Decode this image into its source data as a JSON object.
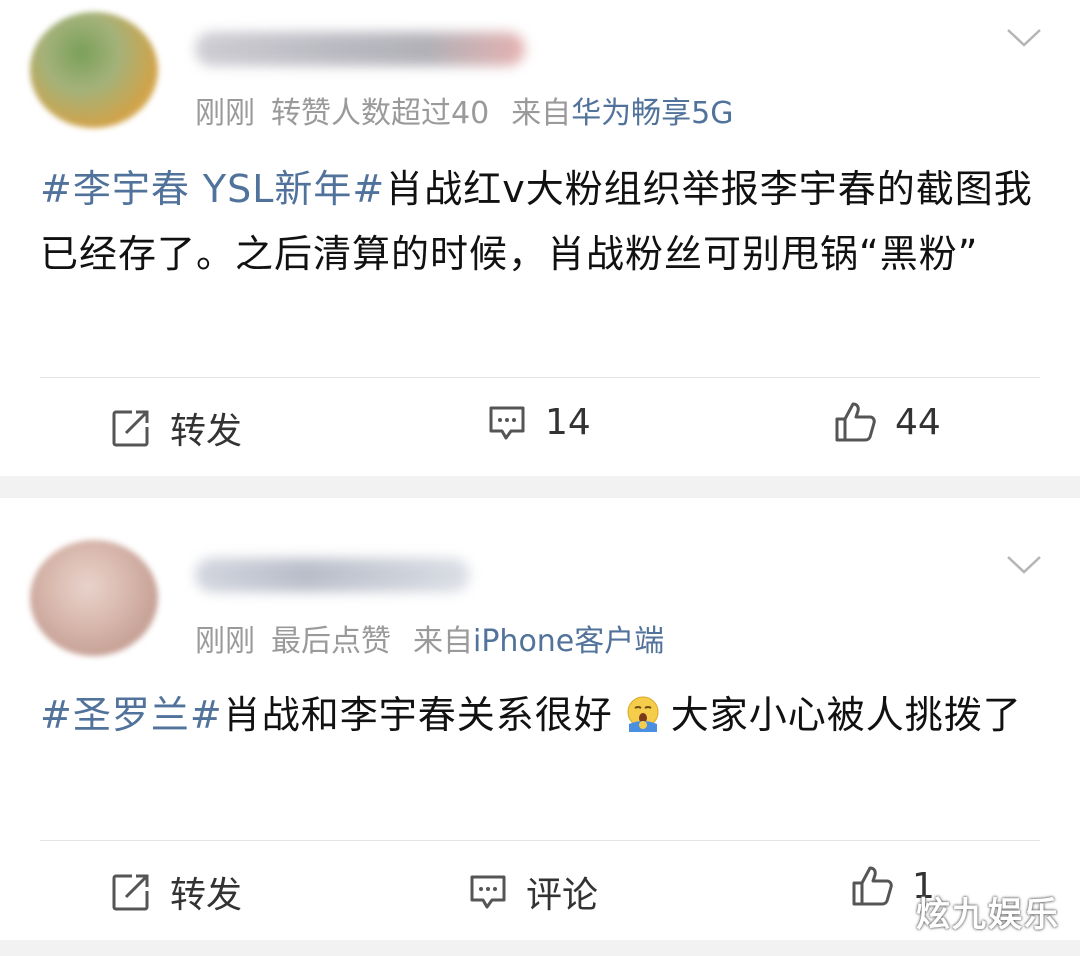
{
  "posts": [
    {
      "meta": {
        "time": "刚刚",
        "activity": "转赞人数超过40",
        "from_label": "来自",
        "source": "华为畅享5G"
      },
      "content": {
        "tag": "#李宇春 YSL新年#",
        "text": "肖战红v大粉组织举报李宇春的截图我已经存了。之后清算的时候，肖战粉丝可别甩锅“黑粉”"
      },
      "actions": {
        "repost": "转发",
        "comment": "14",
        "like": "44"
      }
    },
    {
      "meta": {
        "time": "刚刚",
        "activity": "最后点赞",
        "from_label": "来自",
        "source": "iPhone客户端"
      },
      "content": {
        "tag": "#圣罗兰#",
        "text_before_emoji": "肖战和李宇春关系很好",
        "emoji": "yawn-emoji",
        "text_after_emoji": "大家小心被人挑拨了"
      },
      "actions": {
        "repost": "转发",
        "comment": "评论",
        "like": "1"
      }
    }
  ],
  "watermark": "炫九娱乐",
  "colors": {
    "link": "#51739b",
    "meta": "#9a9a9a",
    "background": "#f2f2f2"
  }
}
